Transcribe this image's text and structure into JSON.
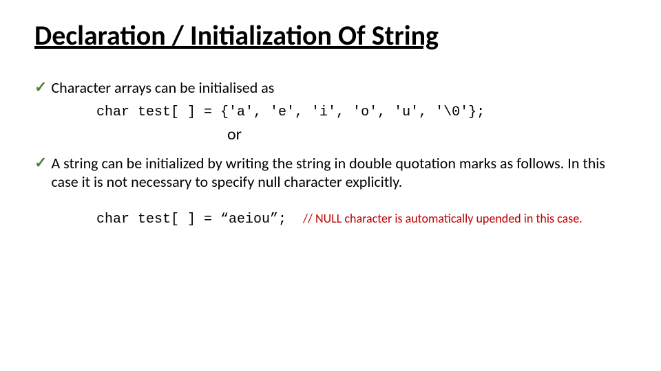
{
  "title": "Declaration / Initialization Of String",
  "bullet1": "Character arrays can be initialised as",
  "code1": "char test[ ] = {'a', 'e', 'i', 'o', 'u', '\\0'};",
  "or": "or",
  "bullet2": "A string can be initialized by writing the string in double quotation marks as follows. In this case it is not necessary to specify null character explicitly.",
  "code2": "char test[ ] = “aeiou”;",
  "comment": "// NULL character is automatically upended in this case."
}
